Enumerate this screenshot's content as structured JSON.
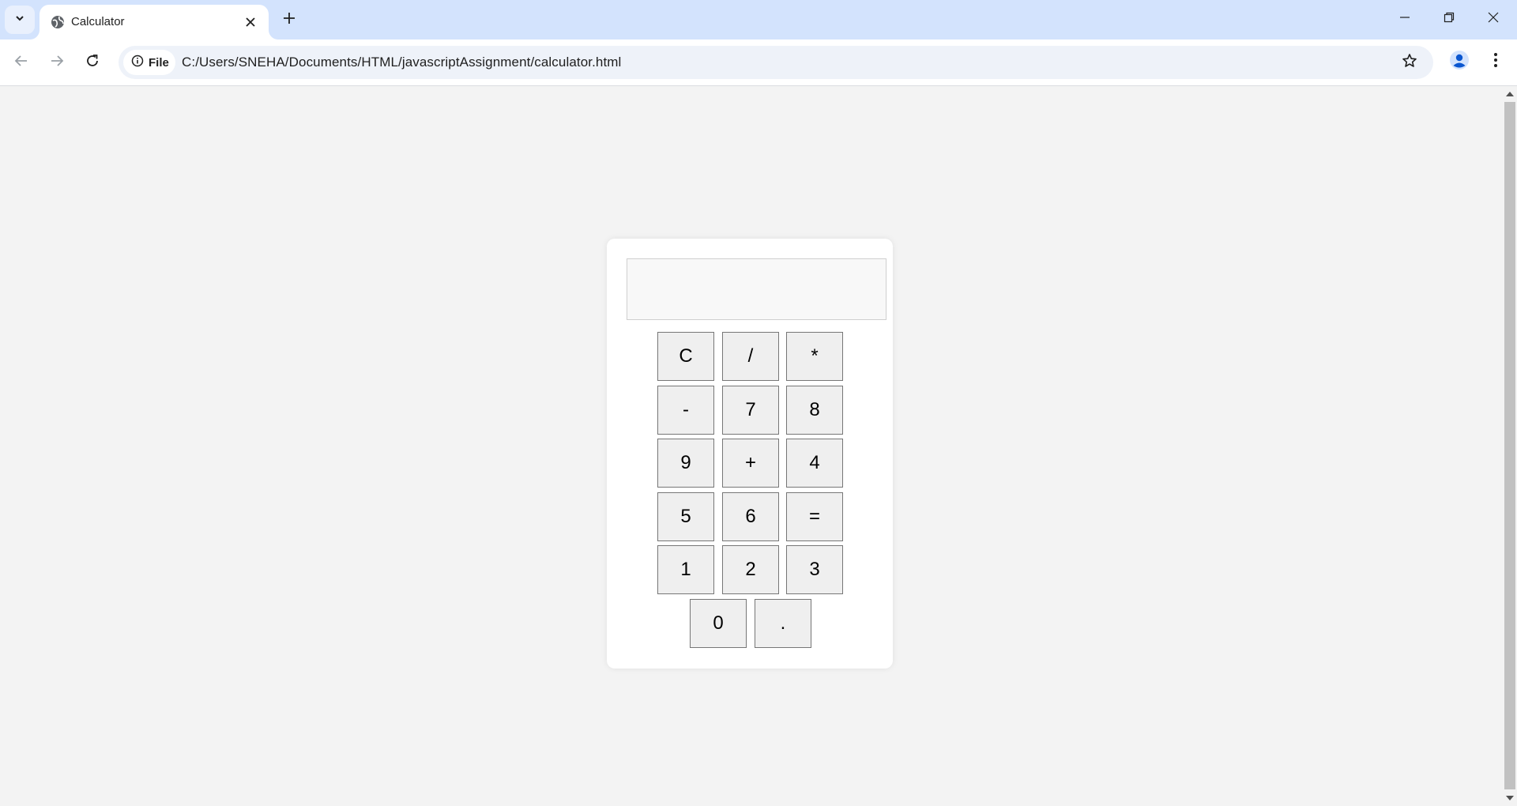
{
  "browser": {
    "tab_title": "Calculator",
    "site_chip_label": "File",
    "url": "C:/Users/SNEHA/Documents/HTML/javascriptAssignment/calculator.html",
    "accent_color": "#d3e3fd"
  },
  "calculator": {
    "display_value": "",
    "rows": [
      [
        "C",
        "/",
        "*"
      ],
      [
        "-",
        "7",
        "8"
      ],
      [
        "9",
        "+",
        "4"
      ],
      [
        "5",
        "6",
        "="
      ],
      [
        "1",
        "2",
        "3"
      ],
      [
        "0",
        "."
      ]
    ]
  }
}
